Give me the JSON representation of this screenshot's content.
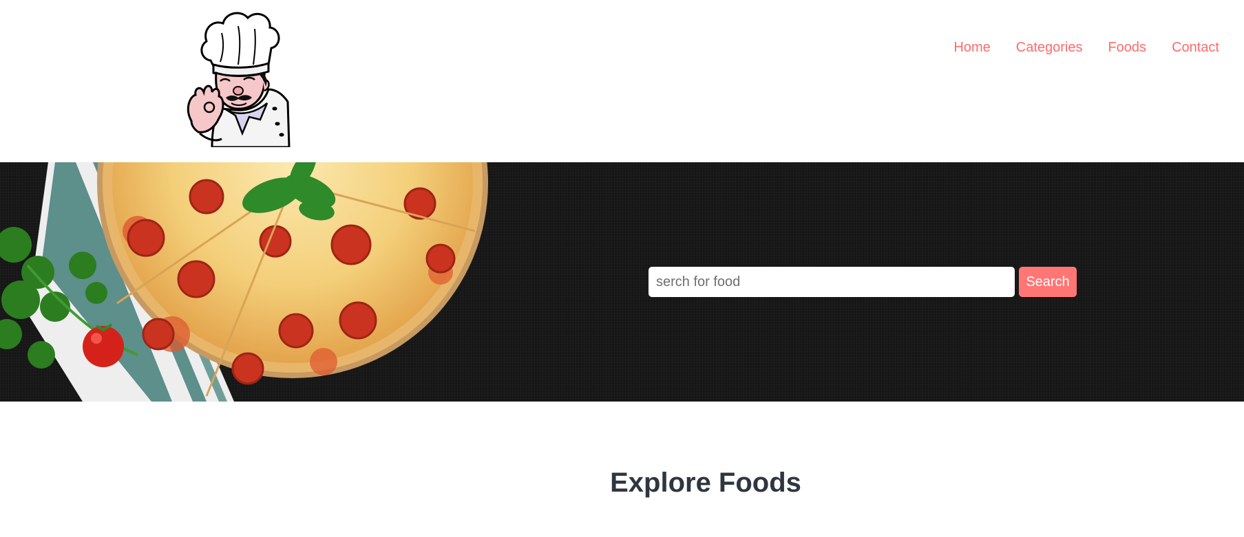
{
  "header": {
    "logo_icon": "chef-mascot-icon",
    "nav": [
      {
        "label": "Home"
      },
      {
        "label": "Categories"
      },
      {
        "label": "Foods"
      },
      {
        "label": "Contact"
      }
    ],
    "nav_color": "#ff6b6b"
  },
  "hero": {
    "image_icon": "pizza-icon",
    "search": {
      "placeholder": "serch for food",
      "value": "",
      "button_label": "Search"
    },
    "button_color": "#ff7675",
    "background_color": "#161616"
  },
  "main": {
    "section_title": "Explore Foods",
    "title_color": "#2f3640"
  }
}
